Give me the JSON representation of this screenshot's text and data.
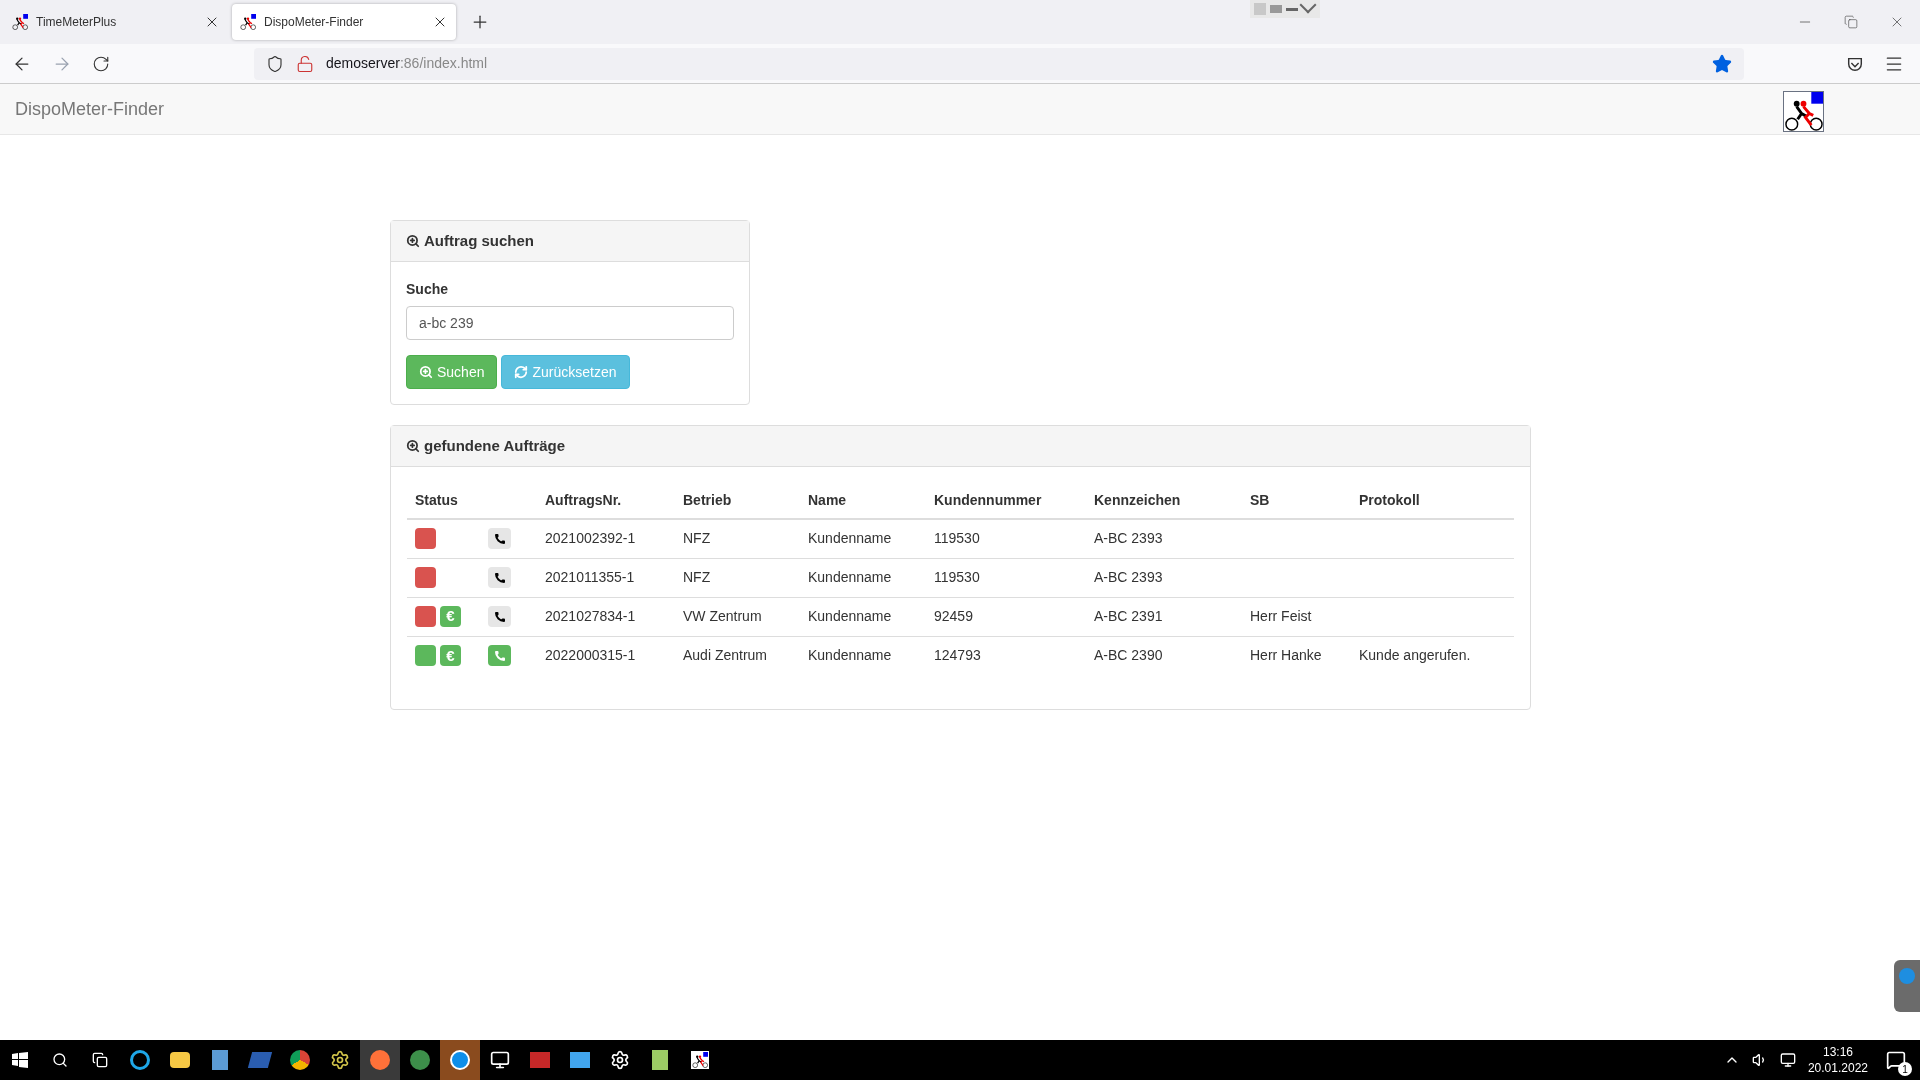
{
  "browser_tabs": [
    {
      "title": "TimeMeterPlus",
      "selected": false
    },
    {
      "title": "DispoMeter-Finder",
      "selected": true
    }
  ],
  "address_bar": {
    "host": "demoserver",
    "path": ":86/index.html"
  },
  "app": {
    "title": "DispoMeter-Finder"
  },
  "search_panel": {
    "title": "Auftrag suchen",
    "label": "Suche",
    "value": "a-bc 239",
    "buttons": [
      {
        "label": "Suchen",
        "kind": "search"
      },
      {
        "label": "Zurücksetzen",
        "kind": "reset"
      }
    ]
  },
  "results_panel": {
    "title": "gefundene Aufträge",
    "columns": [
      "Status",
      "AuftragsNr.",
      "Betrieb",
      "Name",
      "Kundennummer",
      "Kennzeichen",
      "SB",
      "Protokoll"
    ],
    "rows": [
      {
        "done": false,
        "paid": false,
        "called": false,
        "order": "2021002392-1",
        "company": "NFZ",
        "name": "Kundenname",
        "customer_no": "119530",
        "plate": "A-BC 2393"
      },
      {
        "done": false,
        "paid": false,
        "called": false,
        "order": "2021011355-1",
        "company": "NFZ",
        "name": "Kundenname",
        "customer_no": "119530",
        "plate": "A-BC 2393"
      },
      {
        "done": false,
        "paid": true,
        "called": false,
        "paid_symbol": "€",
        "order": "2021027834-1",
        "company": "VW Zentrum",
        "name": "Kundenname",
        "customer_no": "92459",
        "plate": "A-BC 2391",
        "sb": "Herr Feist"
      },
      {
        "done": true,
        "paid": true,
        "called": true,
        "paid_symbol": "€",
        "order": "2022000315-1",
        "company": "Audi Zentrum",
        "name": "Kundenname",
        "customer_no": "124793",
        "plate": "A-BC 2390",
        "sb": "Herr Hanke",
        "log": "Kunde angerufen."
      }
    ]
  },
  "taskbar": {
    "time": "13:16",
    "date": "20.01.2022",
    "notification_count": "1"
  }
}
